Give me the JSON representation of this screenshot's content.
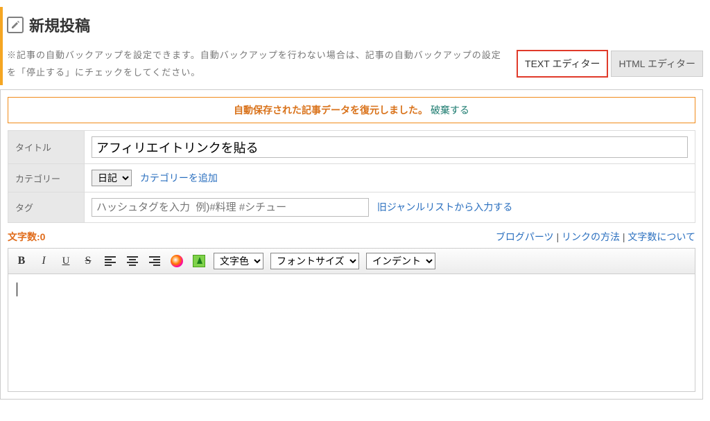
{
  "header": {
    "title": "新規投稿"
  },
  "notice": "※記事の自動バックアップを設定できます。自動バックアップを行わない場合は、記事の自動バックアップの設定を「停止する」にチェックをしてください。",
  "tabs": {
    "text": "TEXT エディター",
    "html": "HTML エディター"
  },
  "restore": {
    "message": "自動保存された記事データを復元しました。",
    "discard": "破棄する"
  },
  "form": {
    "title_label": "タイトル",
    "title_value": "アフィリエイトリンクを貼る",
    "category_label": "カテゴリー",
    "category_selected": "日記",
    "category_add": "カテゴリーを追加",
    "tag_label": "タグ",
    "tag_placeholder": "ハッシュタグを入力  例)#料理 #シチュー",
    "tag_old_genre": "旧ジャンルリストから入力する"
  },
  "meta": {
    "char_count_label": "文字数:",
    "char_count_value": "0",
    "link_parts": "ブログパーツ",
    "link_method": "リンクの方法",
    "link_about_count": "文字数について"
  },
  "toolbar": {
    "font_color": "文字色",
    "font_size": "フォントサイズ",
    "indent": "インデント"
  },
  "colors": {
    "accent_orange": "#f08b1a",
    "link_blue": "#2a6fbf",
    "highlight_red": "#e03a2a"
  }
}
